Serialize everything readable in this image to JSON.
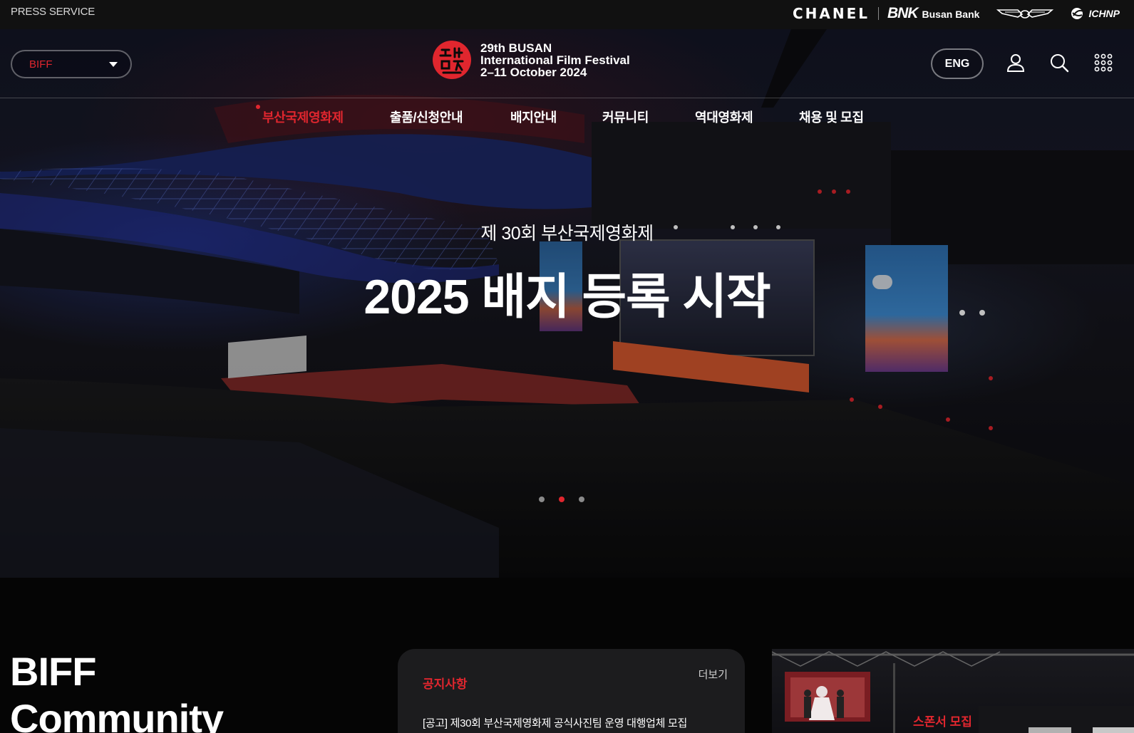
{
  "topbar": {
    "press_label": "PRESS SERVICE",
    "sponsors": {
      "chanel": "CHANEL",
      "bnk_mark": "BNK",
      "bnk_name": "Busan Bank",
      "ichnp": "ICHNP"
    }
  },
  "header": {
    "site_select": "BIFF",
    "logo": {
      "line1": "29th BUSAN",
      "line2": "International Film Festival",
      "line3": "2–11 October 2024"
    },
    "lang_button": "ENG",
    "icons": [
      "user-icon",
      "search-icon",
      "grid-menu-icon"
    ]
  },
  "nav": {
    "items": [
      {
        "label": "부산국제영화제",
        "active": true
      },
      {
        "label": "출품/신청안내",
        "active": false
      },
      {
        "label": "배지안내",
        "active": false
      },
      {
        "label": "커뮤니티",
        "active": false
      },
      {
        "label": "역대영화제",
        "active": false
      },
      {
        "label": "채용 및 모집",
        "active": false
      }
    ]
  },
  "hero": {
    "subtitle": "제 30회 부산국제영화제",
    "title": "2025 배지 등록 시작",
    "slides_total": 3,
    "slide_active": 2
  },
  "community": {
    "title_line1": "BIFF",
    "title_line2": "Community"
  },
  "notice": {
    "heading": "공지사항",
    "more": "더보기",
    "first_item": "[공고] 제30회 부산국제영화제 공식사진팀 운영 대행업체 모집"
  },
  "sponsor_card": {
    "label": "스폰서 모집"
  },
  "colors": {
    "accent": "#e0262e",
    "topbar": "#111111",
    "card": "#1c1c1e"
  }
}
